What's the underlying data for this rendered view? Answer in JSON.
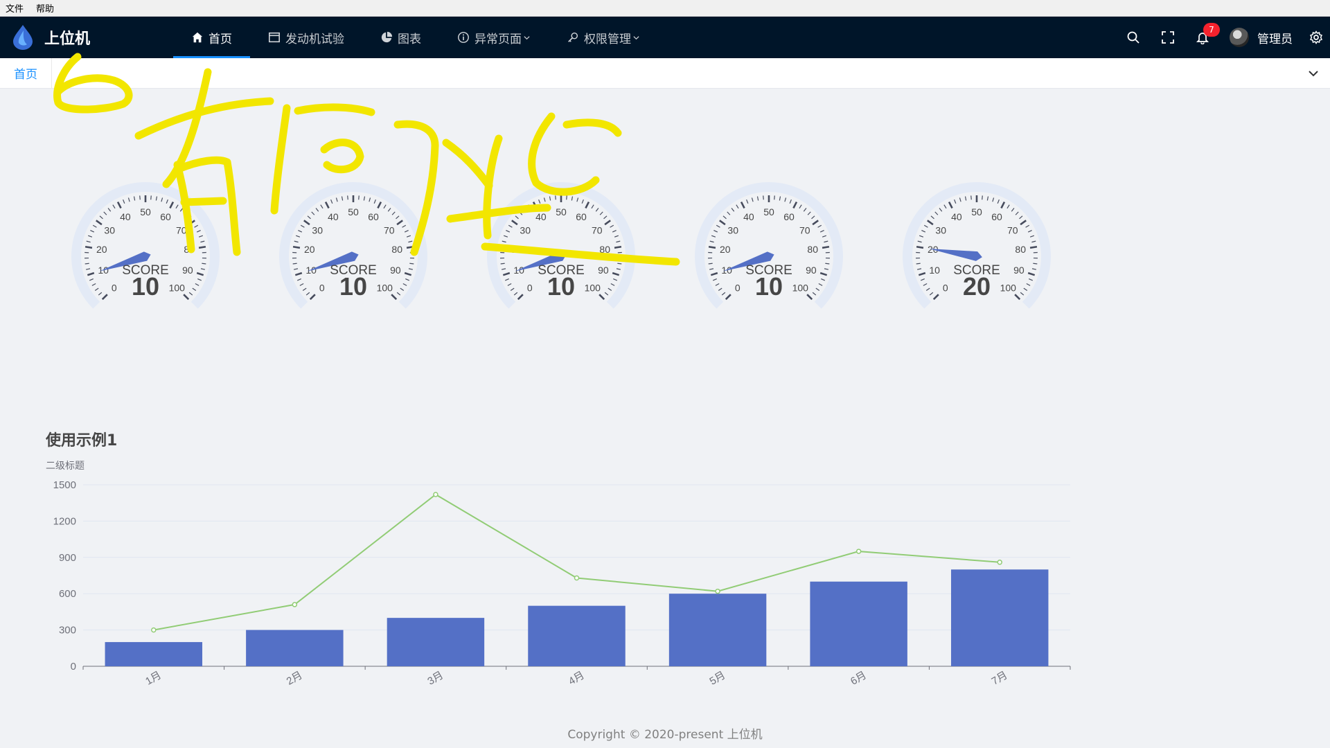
{
  "os_menu": {
    "file": "文件",
    "help": "帮助"
  },
  "app": {
    "title": "上位机"
  },
  "nav": {
    "items": [
      {
        "label": "首页",
        "icon": "home-icon",
        "active": true
      },
      {
        "label": "发动机试验",
        "icon": "window-icon",
        "active": false
      },
      {
        "label": "图表",
        "icon": "pie-chart-icon",
        "active": false
      },
      {
        "label": "异常页面",
        "icon": "info-circle-icon",
        "active": false,
        "dropdown": true
      },
      {
        "label": "权限管理",
        "icon": "key-icon",
        "active": false,
        "dropdown": true
      }
    ]
  },
  "header": {
    "notification_count": "7",
    "user_name": "管理员",
    "icons": [
      "search-icon",
      "fullscreen-icon",
      "bell-icon",
      "settings-icon"
    ]
  },
  "tabs": [
    {
      "label": "首页"
    }
  ],
  "gauges": [
    {
      "title": "SCORE",
      "value": 10,
      "display": "10",
      "min": 0,
      "max": 100,
      "ticks": [
        "0",
        "10",
        "20",
        "30",
        "40",
        "50",
        "60",
        "70",
        "80",
        "90",
        "100"
      ]
    },
    {
      "title": "SCORE",
      "value": 10,
      "display": "10",
      "min": 0,
      "max": 100,
      "ticks": [
        "0",
        "10",
        "20",
        "30",
        "40",
        "50",
        "60",
        "70",
        "80",
        "90",
        "100"
      ]
    },
    {
      "title": "SCORE",
      "value": 10,
      "display": "10",
      "min": 0,
      "max": 100,
      "ticks": [
        "0",
        "10",
        "20",
        "30",
        "40",
        "50",
        "60",
        "70",
        "80",
        "90",
        "100"
      ]
    },
    {
      "title": "SCORE",
      "value": 10,
      "display": "10",
      "min": 0,
      "max": 100,
      "ticks": [
        "0",
        "10",
        "20",
        "30",
        "40",
        "50",
        "60",
        "70",
        "80",
        "90",
        "100"
      ]
    },
    {
      "title": "SCORE",
      "value": 20,
      "display": "20",
      "min": 0,
      "max": 100,
      "ticks": [
        "0",
        "10",
        "20",
        "30",
        "40",
        "50",
        "60",
        "70",
        "80",
        "90",
        "100"
      ]
    }
  ],
  "chart_data": {
    "type": "bar",
    "title": "使用示例1",
    "subtitle": "二级标题",
    "categories": [
      "1月",
      "2月",
      "3月",
      "4月",
      "5月",
      "6月",
      "7月"
    ],
    "series": [
      {
        "type": "bar",
        "values": [
          200,
          300,
          400,
          500,
          600,
          700,
          800
        ],
        "color": "#5470c6"
      },
      {
        "type": "line",
        "values": [
          300,
          510,
          1420,
          730,
          620,
          950,
          860
        ],
        "color": "#91cc75"
      }
    ],
    "yticks": [
      "0",
      "300",
      "600",
      "900",
      "1200",
      "1500"
    ],
    "ylim": [
      0,
      1500
    ],
    "grid": true,
    "legend": false
  },
  "footer": {
    "copyright": "Copyright © 2020-present 上位机"
  },
  "colors": {
    "header_bg": "#001529",
    "accent": "#1890ff",
    "gauge_pointer": "#5470c6",
    "annotation": "#f2e600"
  }
}
